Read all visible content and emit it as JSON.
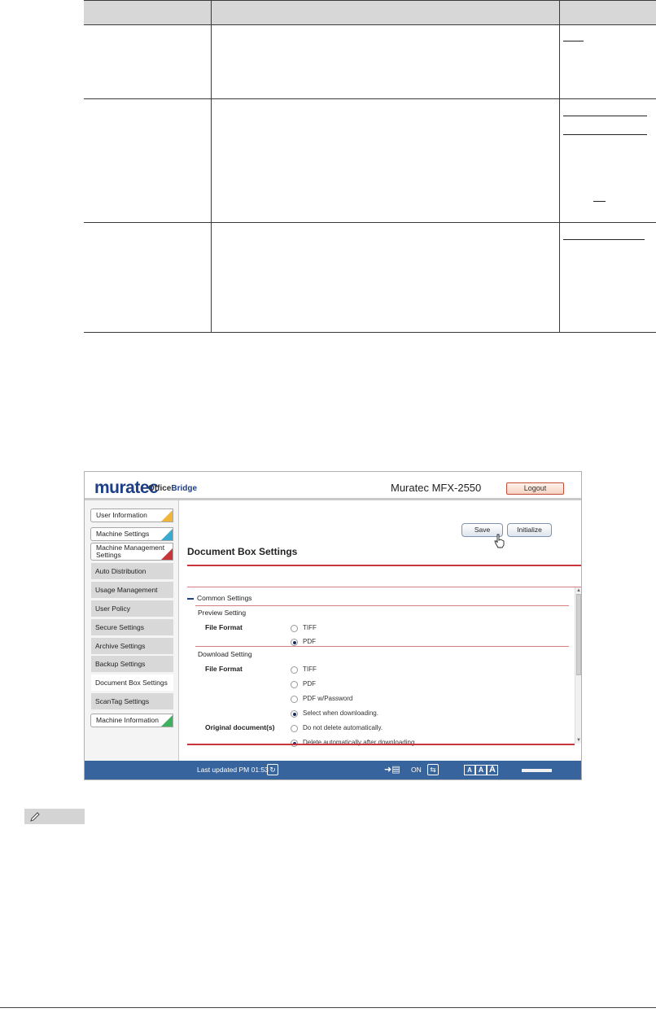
{
  "app": {
    "brand": "muratec",
    "product": "OfficeBridge",
    "product_prefix": "Office",
    "product_suffix": "Bridge",
    "model": "Muratec MFX-2550",
    "logout": "Logout"
  },
  "sidebar": {
    "tabs": [
      {
        "label": "User Information",
        "color": "#f0b63a"
      },
      {
        "label": "Machine Settings",
        "color": "#3aa9cf"
      },
      {
        "label": "Machine Management Settings",
        "line1": "Machine Management",
        "line2": "Settings",
        "color": "#c8353a"
      }
    ],
    "items": [
      {
        "label": "Auto Distribution"
      },
      {
        "label": "Usage Management"
      },
      {
        "label": "User Policy"
      },
      {
        "label": "Secure Settings"
      },
      {
        "label": "Archive Settings"
      },
      {
        "label": "Backup Settings"
      },
      {
        "label": "Document Box Settings",
        "active": true
      },
      {
        "label": "ScanTag Settings"
      }
    ],
    "footer_tab": {
      "label": "Machine Information",
      "color": "#3fb05e"
    }
  },
  "toolbar": {
    "save": "Save",
    "initialize": "Initialize"
  },
  "page": {
    "title": "Document Box Settings"
  },
  "settings": {
    "section": "Common Settings",
    "preview": {
      "heading": "Preview Setting",
      "label": "File Format",
      "options": [
        "TIFF",
        "PDF"
      ],
      "selected": "PDF"
    },
    "download": {
      "heading": "Download Setting",
      "label": "File Format",
      "options": [
        "TIFF",
        "PDF",
        "PDF w/Password",
        "Select when downloading."
      ],
      "selected": "Select when downloading."
    },
    "original": {
      "label": "Original document(s)",
      "options": [
        "Do not delete automatically.",
        "Delete automatically after downloading."
      ],
      "selected": "Delete automatically after downloading."
    }
  },
  "statusbar": {
    "last_updated": "Last updated PM 01:53",
    "on": "ON",
    "font_sizes": [
      "A",
      "A",
      "A"
    ]
  },
  "colors": {
    "accent_blue": "#1c3f87",
    "status_bar": "#37649c",
    "accent_red": "#c8353a"
  }
}
